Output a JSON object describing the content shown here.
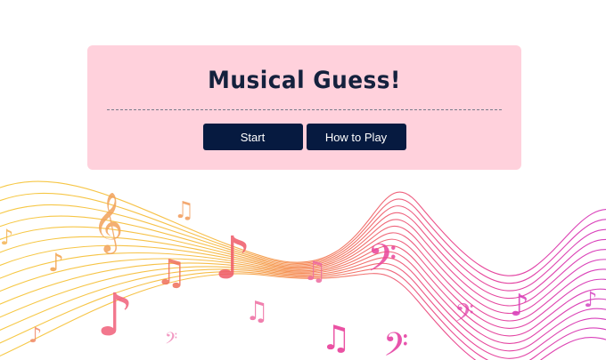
{
  "title": "Musical Guess!",
  "buttons": {
    "start_label": "Start",
    "how_to_play_label": "How to Play"
  },
  "colors": {
    "card_background": "#ffd1dc",
    "title": "#14213d",
    "button_background": "#061a40",
    "button_text": "#ffffff",
    "wave_gradient": [
      "#f6c431",
      "#f47c48",
      "#e7338a",
      "#d12bbd"
    ]
  },
  "decoration": {
    "icons": [
      "treble-clef-icon",
      "bass-clef-icon",
      "eighth-note-icon",
      "beamed-notes-icon",
      "quarter-note-icon"
    ]
  }
}
